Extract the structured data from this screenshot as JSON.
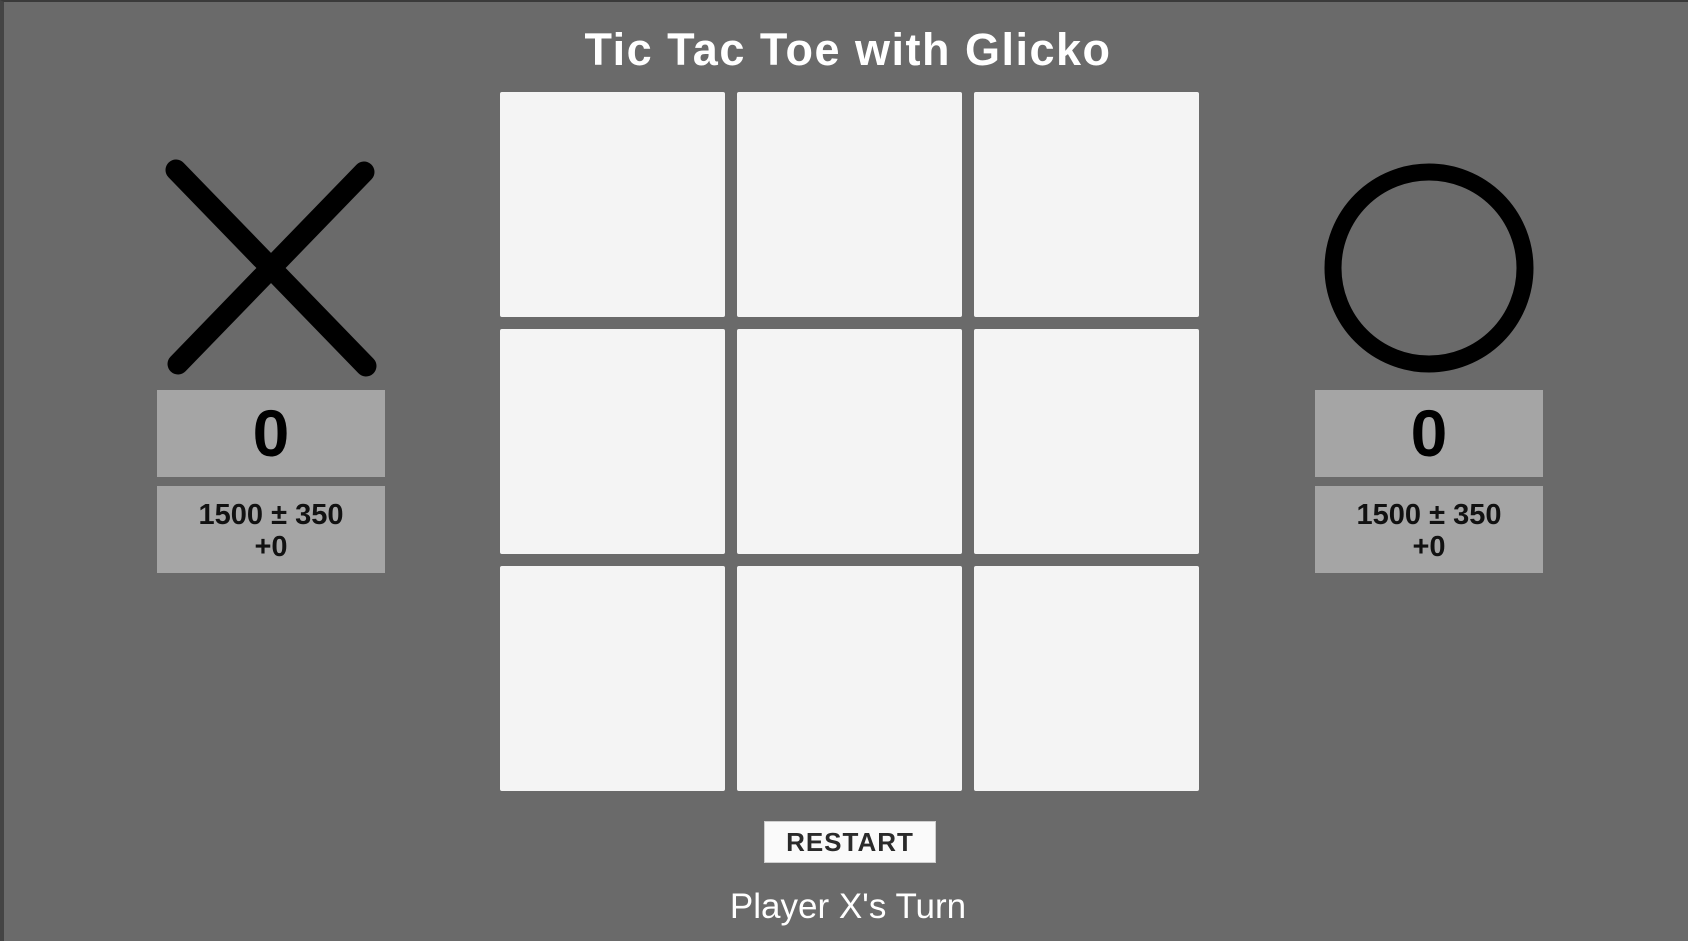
{
  "title": "Tic Tac Toe with Glicko",
  "board": {
    "cells": [
      "",
      "",
      "",
      "",
      "",
      "",
      "",
      "",
      ""
    ]
  },
  "player_x": {
    "symbol_icon": "x-mark-icon",
    "score": "0",
    "rating": "1500 ± 350",
    "rating_change": "+0"
  },
  "player_o": {
    "symbol_icon": "o-mark-icon",
    "score": "0",
    "rating": "1500 ± 350",
    "rating_change": "+0"
  },
  "restart_label": "RESTART",
  "status": "Player X's Turn",
  "colors": {
    "background": "#6a6a6a",
    "cell": "#f4f4f4",
    "panel": "#a5a5a5",
    "mark": "#000000"
  }
}
